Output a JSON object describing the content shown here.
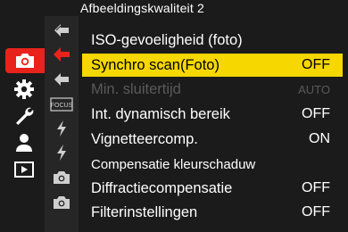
{
  "header": {
    "title": "Afbeeldingskwaliteit 2"
  },
  "categories": [
    {
      "icon": "camera-icon",
      "active": true
    },
    {
      "icon": "gear-icon",
      "active": false
    },
    {
      "icon": "wrench-icon",
      "active": false
    },
    {
      "icon": "person-icon",
      "active": false
    },
    {
      "icon": "playback-icon",
      "active": false
    }
  ],
  "subpages": [
    {
      "icon": "page-arrow-icon"
    },
    {
      "icon": "page-arrow-active-icon"
    },
    {
      "icon": "page-arrow-icon"
    },
    {
      "icon": "focus-icon",
      "text": "FOCUS"
    },
    {
      "icon": "flash-icon"
    },
    {
      "icon": "flash-icon"
    },
    {
      "icon": "camera-icon"
    },
    {
      "icon": "camera-icon"
    }
  ],
  "menu": {
    "items": [
      {
        "label": "ISO-gevoeligheid (foto)",
        "value": ""
      },
      {
        "label": "Synchro scan(Foto)",
        "value": "OFF"
      },
      {
        "label": "Min. sluitertijd",
        "value": "AUTO"
      },
      {
        "label": "Int. dynamisch bereik",
        "value": "OFF"
      },
      {
        "label": "Vignetteercomp.",
        "value": "ON"
      },
      {
        "label": "Compensatie kleurschaduw",
        "value": ""
      },
      {
        "label": "Diffractiecompensatie",
        "value": "OFF"
      },
      {
        "label": "Filterinstellingen",
        "value": "OFF"
      }
    ]
  },
  "colors": {
    "accent_red": "#e8231c",
    "highlight_yellow": "#f6d700",
    "disabled_gray": "#5a5a5a"
  }
}
